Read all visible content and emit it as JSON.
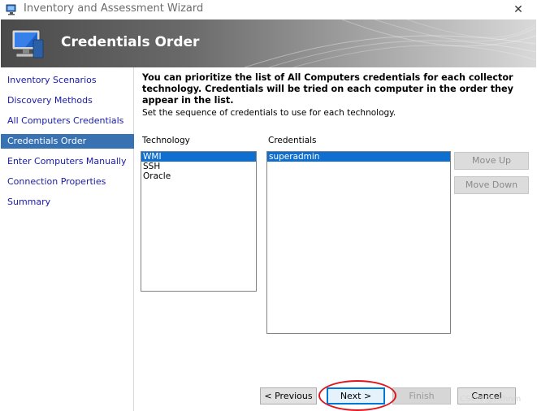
{
  "window": {
    "title": "Inventory and Assessment Wizard",
    "close_glyph": "✕",
    "app_icon": "wizard-app-icon"
  },
  "banner": {
    "title": "Credentials Order",
    "icon": "computer-monitor-icon"
  },
  "nav": {
    "items": [
      {
        "label": "Inventory Scenarios",
        "active": false
      },
      {
        "label": "Discovery Methods",
        "active": false
      },
      {
        "label": "All Computers Credentials",
        "active": false
      },
      {
        "label": "Credentials Order",
        "active": true
      },
      {
        "label": "Enter Computers Manually",
        "active": false
      },
      {
        "label": "Connection Properties",
        "active": false
      },
      {
        "label": "Summary",
        "active": false
      }
    ]
  },
  "main": {
    "intro": "You can prioritize the list of All Computers credentials for each collector technology. Credentials will be tried on each computer in the order they appear in the list.",
    "instruction": "Set the sequence of credentials to use for each technology.",
    "technology": {
      "label": "Technology",
      "items": [
        {
          "text": "WMI",
          "selected": true
        },
        {
          "text": "SSH",
          "selected": false
        },
        {
          "text": "Oracle",
          "selected": false
        }
      ]
    },
    "credentials": {
      "label": "Credentials",
      "items": [
        {
          "text": "superadmin",
          "selected": true
        }
      ]
    },
    "move_up_label": "Move Up",
    "move_down_label": "Move Down"
  },
  "footer": {
    "previous_label": "< Previous",
    "next_label": "Next >",
    "finish_label": "Finish",
    "cancel_label": "Cancel"
  },
  "watermark": "CSDN @zxhnm",
  "colors": {
    "accent": "#3872b3",
    "selection": "#0f6fd0",
    "annotation_circle": "#e0141f",
    "nav_link": "#1a1aa8"
  }
}
